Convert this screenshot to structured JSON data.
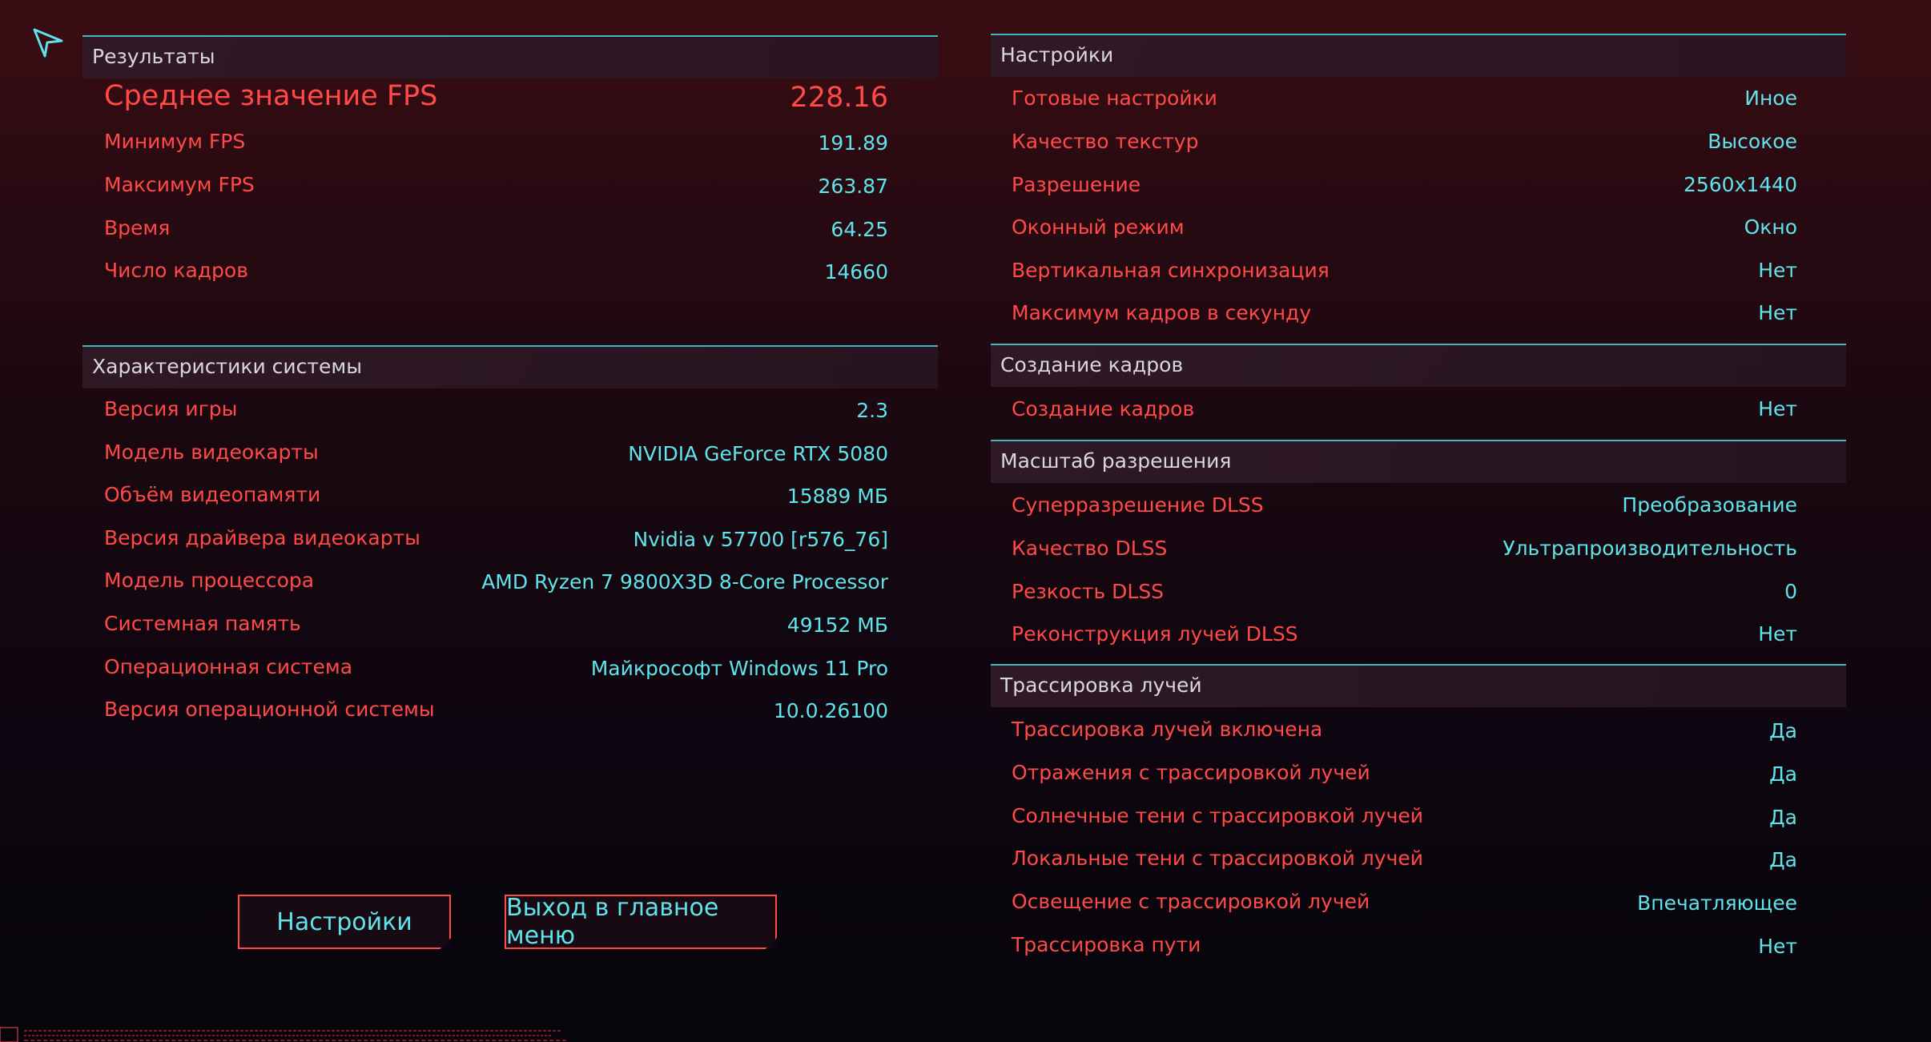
{
  "results": {
    "header": "Результаты",
    "avg_label": "Среднее значение FPS",
    "avg_value": "228.16",
    "rows": [
      {
        "label": "Минимум FPS",
        "value": "191.89"
      },
      {
        "label": "Максимум FPS",
        "value": "263.87"
      },
      {
        "label": "Время",
        "value": "64.25"
      },
      {
        "label": "Число кадров",
        "value": "14660"
      }
    ]
  },
  "system": {
    "header": "Характеристики системы",
    "rows": [
      {
        "label": "Версия игры",
        "value": "2.3"
      },
      {
        "label": "Модель видеокарты",
        "value": "NVIDIA GeForce RTX 5080"
      },
      {
        "label": "Объём видеопамяти",
        "value": "15889 МБ"
      },
      {
        "label": "Версия драйвера видеокарты",
        "value": "Nvidia v 57700 [r576_76]"
      },
      {
        "label": "Модель процессора",
        "value": "AMD Ryzen 7 9800X3D 8-Core Processor"
      },
      {
        "label": "Системная память",
        "value": "49152 МБ"
      },
      {
        "label": "Операционная система",
        "value": "Майкрософт Windows 11 Pro"
      },
      {
        "label": "Версия операционной системы",
        "value": "10.0.26100"
      }
    ]
  },
  "settings": {
    "header": "Настройки",
    "rows": [
      {
        "label": "Готовые настройки",
        "value": "Иное"
      },
      {
        "label": "Качество текстур",
        "value": "Высокое"
      },
      {
        "label": "Разрешение",
        "value": "2560x1440"
      },
      {
        "label": "Оконный режим",
        "value": "Окно"
      },
      {
        "label": "Вертикальная синхронизация",
        "value": "Нет"
      },
      {
        "label": "Максимум кадров в секунду",
        "value": "Нет"
      }
    ]
  },
  "frame_gen": {
    "header": "Создание кадров",
    "rows": [
      {
        "label": "Создание кадров",
        "value": "Нет"
      }
    ]
  },
  "resolution_scaling": {
    "header": "Масштаб разрешения",
    "rows": [
      {
        "label": "Суперразрешение DLSS",
        "value": "Преобразование"
      },
      {
        "label": "Качество DLSS",
        "value": "Ультрапроизводительность"
      },
      {
        "label": "Резкость DLSS",
        "value": "0"
      },
      {
        "label": "Реконструкция лучей DLSS",
        "value": "Нет"
      }
    ]
  },
  "ray_tracing": {
    "header": "Трассировка лучей",
    "rows": [
      {
        "label": "Трассировка лучей включена",
        "value": "Да"
      },
      {
        "label": "Отражения с трассировкой лучей",
        "value": "Да"
      },
      {
        "label": "Солнечные тени с трассировкой лучей",
        "value": "Да"
      },
      {
        "label": "Локальные тени с трассировкой лучей",
        "value": "Да"
      },
      {
        "label": "Освещение с трассировкой лучей",
        "value": "Впечатляющее"
      },
      {
        "label": "Трассировка пути",
        "value": "Нет"
      }
    ]
  },
  "buttons": {
    "settings": "Настройки",
    "exit": "Выход в главное меню"
  },
  "colors": {
    "label_red": "#ff4a48",
    "value_cyan": "#5ee4ea",
    "header_line": "#3fb8c0",
    "header_text": "#d8d8dc"
  },
  "icons": {
    "cursor": "arrow-pointer-icon"
  }
}
